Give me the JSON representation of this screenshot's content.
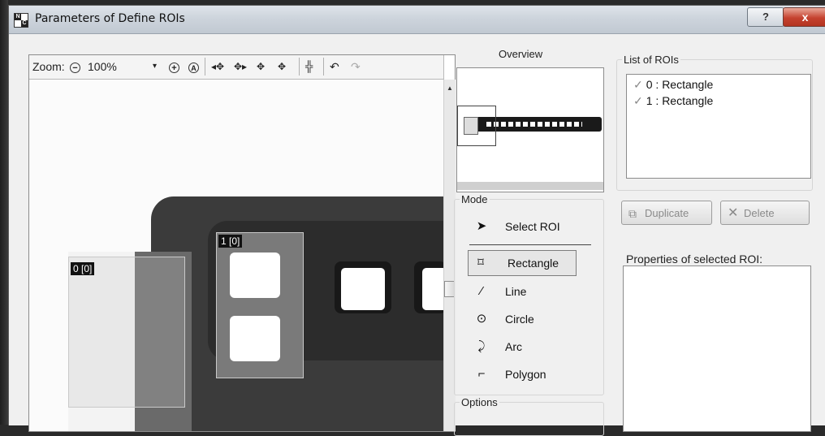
{
  "window": {
    "title": "Parameters of Define ROIs",
    "help_label": "?",
    "close_label": "x"
  },
  "toolbar": {
    "zoom_label": "Zoom:",
    "zoom_value": "100%"
  },
  "canvas": {
    "roi_labels": [
      "0 [0]",
      "1 [0]"
    ]
  },
  "overview": {
    "label": "Overview"
  },
  "mode": {
    "group_label": "Mode",
    "items": [
      {
        "label": "Select ROI",
        "icon": "arrow-cursor-icon"
      },
      {
        "label": "Rectangle",
        "icon": "rectangle-icon",
        "selected": true
      },
      {
        "label": "Line",
        "icon": "line-icon"
      },
      {
        "label": "Circle",
        "icon": "circle-icon"
      },
      {
        "label": "Arc",
        "icon": "arc-icon"
      },
      {
        "label": "Polygon",
        "icon": "polygon-icon"
      }
    ]
  },
  "options": {
    "group_label": "Options"
  },
  "roi_list": {
    "group_label": "List of ROIs",
    "items": [
      "0 : Rectangle",
      "1 : Rectangle"
    ]
  },
  "buttons": {
    "duplicate": "Duplicate",
    "delete": "Delete"
  },
  "properties": {
    "label": "Properties of selected ROI:"
  },
  "colors": {
    "close_red": "#c5422f",
    "title_bar": "#cdd4dc"
  }
}
